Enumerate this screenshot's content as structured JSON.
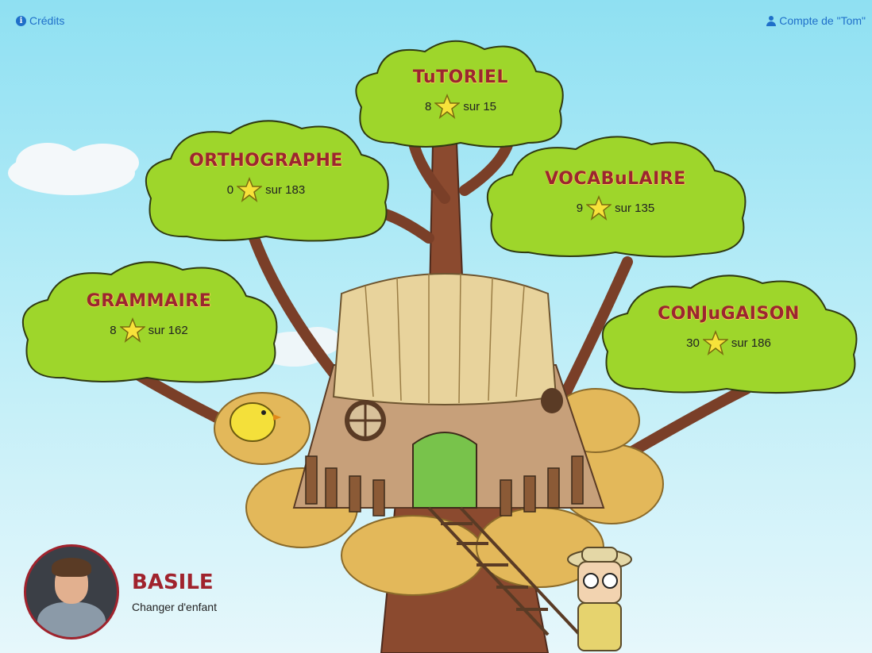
{
  "topbar": {
    "credits_label": "Crédits",
    "account_label": "Compte de \"Tom\""
  },
  "categories": [
    {
      "title": "TuTORIEL",
      "earned": "8",
      "total_text": "sur 15"
    },
    {
      "title": "ORTHOGRAPHE",
      "earned": "0",
      "total_text": "sur 183"
    },
    {
      "title": "VOCABuLAIRE",
      "earned": "9",
      "total_text": "sur 135"
    },
    {
      "title": "GRAMMAIRE",
      "earned": "8",
      "total_text": "sur 162"
    },
    {
      "title": "CONJuGAISON",
      "earned": "30",
      "total_text": "sur 186"
    }
  ],
  "profile": {
    "name": "BASILE",
    "change_label": "Changer d'enfant"
  },
  "colors": {
    "canopy": "#9ed62b",
    "title": "#9b2630",
    "link": "#1f6fc9",
    "trunk": "#8b4a2f"
  }
}
